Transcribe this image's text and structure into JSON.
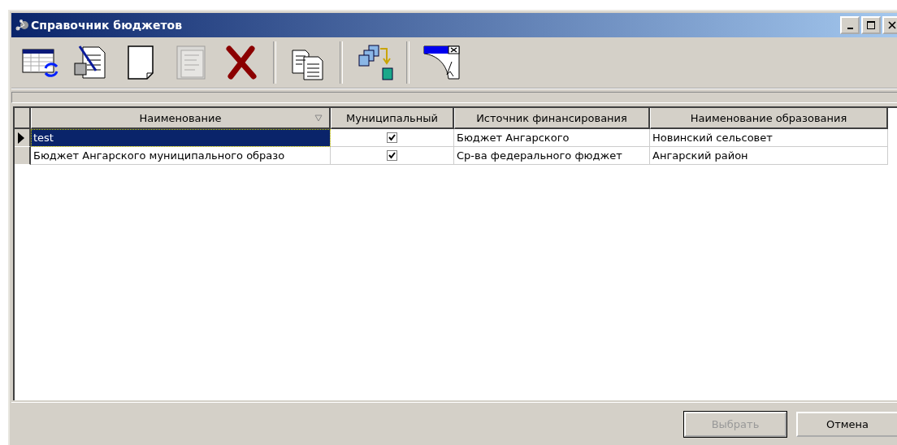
{
  "window": {
    "title": "Справочник бюджетов"
  },
  "toolbar": [
    {
      "kind": "refresh",
      "disabled": false
    },
    {
      "kind": "edit",
      "disabled": false
    },
    {
      "kind": "new",
      "disabled": false
    },
    {
      "kind": "properties",
      "disabled": true
    },
    {
      "kind": "delete",
      "disabled": false
    },
    {
      "kind": "separator"
    },
    {
      "kind": "copy",
      "disabled": false
    },
    {
      "kind": "separator"
    },
    {
      "kind": "move",
      "disabled": false
    },
    {
      "kind": "separator"
    },
    {
      "kind": "filter",
      "disabled": false
    }
  ],
  "table": {
    "columns": [
      {
        "label": "Наименование",
        "sorted": true
      },
      {
        "label": "Муниципальный",
        "sorted": false
      },
      {
        "label": "Источник финансирования",
        "sorted": false
      },
      {
        "label": "Наименование образования",
        "sorted": false
      }
    ],
    "rows": [
      {
        "selected": true,
        "name": "test",
        "municipal": true,
        "source": "Бюджет Ангарского",
        "entity": "Новинский сельсовет"
      },
      {
        "selected": false,
        "name": "Бюджет Ангарского муниципального образо",
        "municipal": true,
        "source": "Ср-ва федерального фюджет",
        "entity": "Ангарский район"
      }
    ]
  },
  "buttons": [
    {
      "label": "Выбрать",
      "disabled": true
    },
    {
      "label": "Отмена",
      "disabled": false
    }
  ]
}
